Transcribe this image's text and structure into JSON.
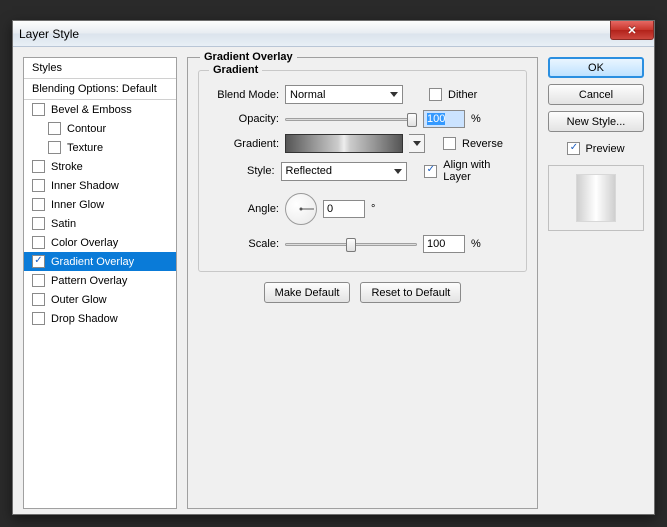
{
  "window": {
    "title": "Layer Style",
    "close": "✕"
  },
  "left": {
    "header": "Styles",
    "blending": "Blending Options: Default",
    "items": [
      {
        "label": "Bevel & Emboss",
        "checked": false,
        "sub": false
      },
      {
        "label": "Contour",
        "checked": false,
        "sub": true
      },
      {
        "label": "Texture",
        "checked": false,
        "sub": true
      },
      {
        "label": "Stroke",
        "checked": false,
        "sub": false
      },
      {
        "label": "Inner Shadow",
        "checked": false,
        "sub": false
      },
      {
        "label": "Inner Glow",
        "checked": false,
        "sub": false
      },
      {
        "label": "Satin",
        "checked": false,
        "sub": false
      },
      {
        "label": "Color Overlay",
        "checked": false,
        "sub": false
      },
      {
        "label": "Gradient Overlay",
        "checked": true,
        "sub": false,
        "selected": true
      },
      {
        "label": "Pattern Overlay",
        "checked": false,
        "sub": false
      },
      {
        "label": "Outer Glow",
        "checked": false,
        "sub": false
      },
      {
        "label": "Drop Shadow",
        "checked": false,
        "sub": false
      }
    ]
  },
  "center": {
    "section_title": "Gradient Overlay",
    "group_title": "Gradient",
    "labels": {
      "blend_mode": "Blend Mode:",
      "opacity": "Opacity:",
      "gradient": "Gradient:",
      "style": "Style:",
      "angle": "Angle:",
      "scale": "Scale:"
    },
    "blend_mode_value": "Normal",
    "dither_label": "Dither",
    "dither_checked": false,
    "opacity_value": "100",
    "opacity_unit": "%",
    "reverse_label": "Reverse",
    "reverse_checked": false,
    "style_value": "Reflected",
    "align_label": "Align with Layer",
    "align_checked": true,
    "angle_value": "0",
    "angle_unit": "°",
    "scale_value": "100",
    "scale_unit": "%",
    "make_default": "Make Default",
    "reset_default": "Reset to Default"
  },
  "right": {
    "ok": "OK",
    "cancel": "Cancel",
    "new_style": "New Style...",
    "preview_label": "Preview",
    "preview_checked": true
  }
}
